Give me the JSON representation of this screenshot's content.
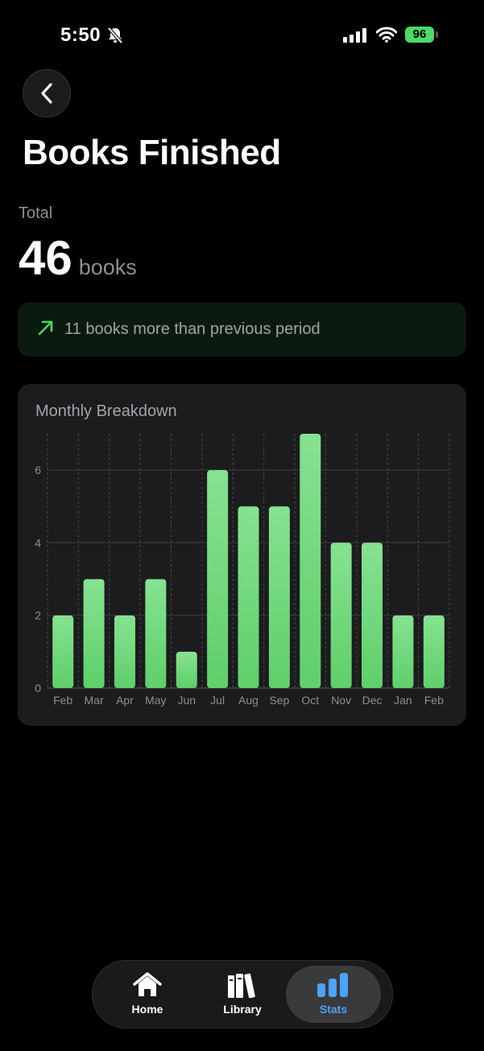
{
  "status_bar": {
    "time": "5:50",
    "battery": "96"
  },
  "header": {
    "title": "Books Finished"
  },
  "total": {
    "label": "Total",
    "value": "46",
    "unit": "books"
  },
  "trend": {
    "text": "11 books more than previous period",
    "color": "#4cd964"
  },
  "card": {
    "title": "Monthly Breakdown"
  },
  "chart_data": {
    "type": "bar",
    "categories": [
      "Feb",
      "Mar",
      "Apr",
      "May",
      "Jun",
      "Jul",
      "Aug",
      "Sep",
      "Oct",
      "Nov",
      "Dec",
      "Jan",
      "Feb"
    ],
    "values": [
      2,
      3,
      2,
      3,
      1,
      6,
      5,
      5,
      7,
      4,
      4,
      2,
      2
    ],
    "yticks": [
      0,
      2,
      4,
      6
    ],
    "ylim": [
      0,
      7
    ],
    "grid": true,
    "bar_color": "#6fdc7f"
  },
  "tabbar": {
    "tabs": [
      {
        "label": "Home",
        "icon": "house-icon",
        "active": false
      },
      {
        "label": "Library",
        "icon": "books-icon",
        "active": false
      },
      {
        "label": "Stats",
        "icon": "bar-chart-icon",
        "active": true
      }
    ],
    "active_color": "#4aa3ff"
  }
}
